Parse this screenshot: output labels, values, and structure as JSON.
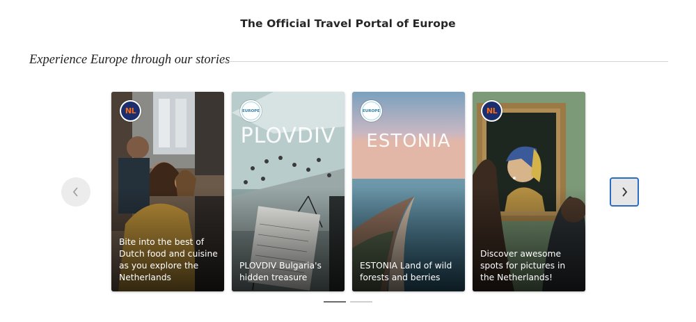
{
  "header": {
    "title": "The Official Travel Portal of Europe"
  },
  "section": {
    "title": "Experience Europe through our stories"
  },
  "carousel": {
    "prev_icon": "chevron-left-icon",
    "next_icon": "chevron-right-icon",
    "cards": [
      {
        "badge": "NL",
        "headline": "",
        "caption": "Bite into the best of Dutch food and cuisine as you explore the Netherlands"
      },
      {
        "badge": "EUROPE",
        "headline": "PLOVDIV",
        "caption": "PLOVDIV Bulgaria's hidden treasure"
      },
      {
        "badge": "EUROPE",
        "headline": "ESTONIA",
        "caption": "ESTONIA Land of wild forests and berries"
      },
      {
        "badge": "NL",
        "headline": "",
        "caption": "Discover awesome spots for pictures in the Netherlands!"
      }
    ],
    "pagination": {
      "pages": 2,
      "active": 1
    }
  }
}
